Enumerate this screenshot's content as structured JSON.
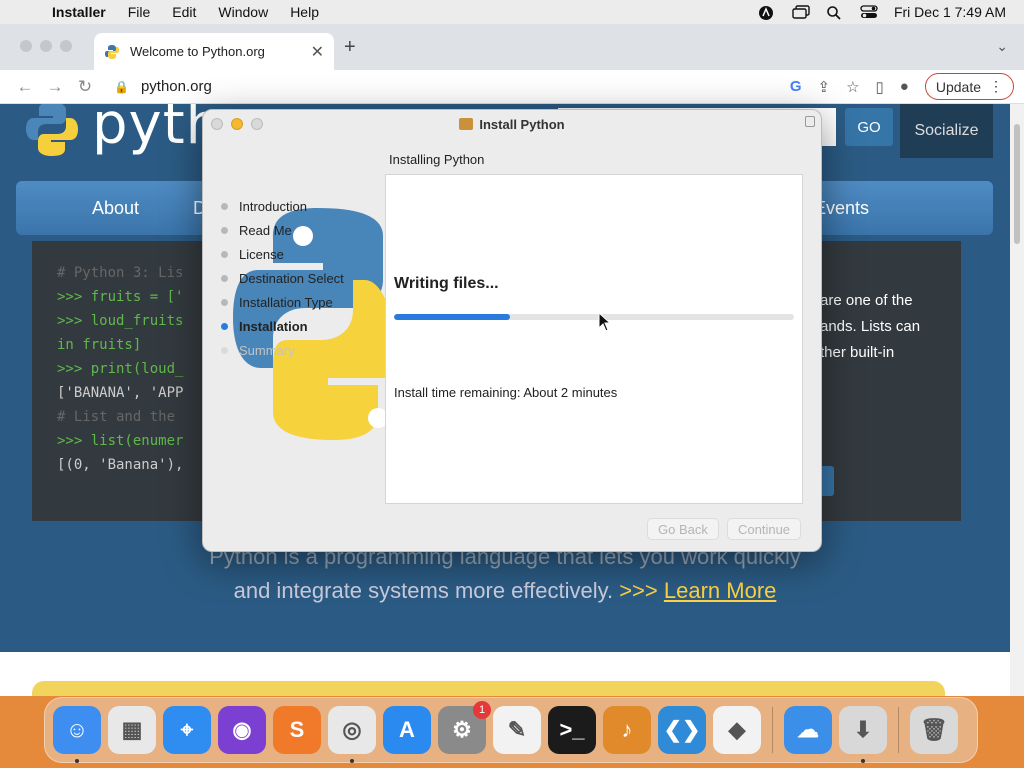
{
  "menubar": {
    "app_name": "Installer",
    "menus": [
      "File",
      "Edit",
      "Window",
      "Help"
    ],
    "datetime": "Fri Dec 1  7:49 AM"
  },
  "browser": {
    "tab_title": "Welcome to Python.org",
    "url": "python.org",
    "update_label": "Update"
  },
  "webpage": {
    "logo_text": "pytho",
    "go_label": "GO",
    "socialize_label": "Socialize",
    "nav": [
      "About",
      "Do",
      "Events"
    ],
    "code_lines": [
      {
        "text": "# Python 3: Lis",
        "kind": "comment"
      },
      {
        "text": ">>> fruits = ['",
        "kind": "green"
      },
      {
        "text": ">>> loud_fruits",
        "kind": "green"
      },
      {
        "text": "in fruits]",
        "kind": "green"
      },
      {
        "text": ">>> print(loud_",
        "kind": "green"
      },
      {
        "text": "['BANANA', 'APP",
        "kind": "white"
      },
      {
        "text": "",
        "kind": "white"
      },
      {
        "text": "# List and the",
        "kind": "comment"
      },
      {
        "text": ">>> list(enumer",
        "kind": "green"
      },
      {
        "text": "[(0, 'Banana'),",
        "kind": "white"
      }
    ],
    "side_lines": [
      "are one of the",
      "ands. Lists can",
      "ther built-in"
    ],
    "tagline_line1": "Python is a programming language that lets you work quickly",
    "tagline_line2": "and integrate systems more effectively.",
    "tagline_chevrons": ">>>",
    "learn_more": "Learn More"
  },
  "installer": {
    "title": "Install Python",
    "heading": "Installing Python",
    "steps": [
      {
        "label": "Introduction",
        "state": "done"
      },
      {
        "label": "Read Me",
        "state": "done"
      },
      {
        "label": "License",
        "state": "done"
      },
      {
        "label": "Destination Select",
        "state": "done"
      },
      {
        "label": "Installation Type",
        "state": "done"
      },
      {
        "label": "Installation",
        "state": "active"
      },
      {
        "label": "Summary",
        "state": "pending"
      }
    ],
    "status": "Writing files...",
    "progress": 0.29,
    "remaining": "Install time remaining: About 2 minutes",
    "back_label": "Go Back",
    "continue_label": "Continue"
  },
  "dock": {
    "apps": [
      {
        "name": "finder",
        "color": "#3d8ef0",
        "glyph": "☺",
        "running": true
      },
      {
        "name": "launchpad",
        "color": "#e8e8e8",
        "glyph": "▦",
        "running": false
      },
      {
        "name": "safari",
        "color": "#2f8cf0",
        "glyph": "⌖",
        "running": false
      },
      {
        "name": "firefox",
        "color": "#7b3fd1",
        "glyph": "◉",
        "running": false
      },
      {
        "name": "sublime",
        "color": "#f07a2a",
        "glyph": "S",
        "running": false
      },
      {
        "name": "chrome",
        "color": "#e8e8e8",
        "glyph": "◎",
        "running": true
      },
      {
        "name": "app-store",
        "color": "#2b8af0",
        "glyph": "A",
        "running": false
      },
      {
        "name": "system-preferences",
        "color": "#8a8a8a",
        "glyph": "⚙",
        "running": false,
        "badge": "1"
      },
      {
        "name": "textedit",
        "color": "#f2f2f2",
        "glyph": "✎",
        "running": false
      },
      {
        "name": "terminal",
        "color": "#1b1b1b",
        "glyph": ">_",
        "running": false
      },
      {
        "name": "garageband",
        "color": "#e08a2c",
        "glyph": "♪",
        "running": false
      },
      {
        "name": "vscode",
        "color": "#2f8ad8",
        "glyph": "❮❯",
        "running": false
      },
      {
        "name": "visual-studio",
        "color": "#f2f2f2",
        "glyph": "◆",
        "running": false
      }
    ],
    "extras": [
      {
        "name": "weather",
        "color": "#3b8fe8",
        "glyph": "☁",
        "running": false
      },
      {
        "name": "installer",
        "color": "#d8d8d8",
        "glyph": "⬇",
        "running": true
      },
      {
        "name": "trash",
        "color": "#d9d9d9",
        "glyph": "🗑",
        "running": false
      }
    ]
  }
}
